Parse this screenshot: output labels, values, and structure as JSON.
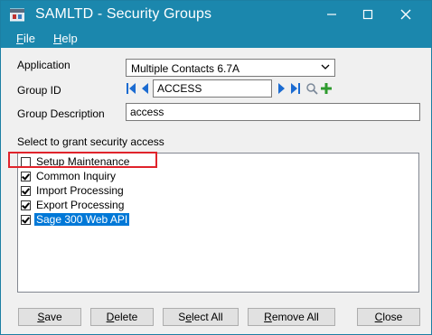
{
  "window": {
    "title": "SAMLTD - Security Groups",
    "minimize_glyph": "—",
    "maximize_glyph": "☐",
    "close_glyph": "✕"
  },
  "menu": {
    "file_hotkey": "F",
    "file_rest": "ile",
    "help_hotkey": "H",
    "help_rest": "elp"
  },
  "form": {
    "application_label": "Application",
    "application_value": "Multiple Contacts 6.7A",
    "group_id_label": "Group ID",
    "group_id_value": "ACCESS",
    "group_description_label": "Group Description",
    "group_description_value": "access",
    "grant_label": "Select to grant security access"
  },
  "permissions": [
    {
      "label": "Setup Maintenance",
      "checked": false,
      "selected": false
    },
    {
      "label": "Common Inquiry",
      "checked": true,
      "selected": false
    },
    {
      "label": "Import Processing",
      "checked": true,
      "selected": false
    },
    {
      "label": "Export Processing",
      "checked": true,
      "selected": false
    },
    {
      "label": "Sage 300 Web API",
      "checked": true,
      "selected": true
    }
  ],
  "buttons": {
    "save_hotkey": "S",
    "save_rest": "ave",
    "delete_hotkey": "D",
    "delete_rest": "elete",
    "select_all_pre": "S",
    "select_all_hotkey": "e",
    "select_all_rest": "lect All",
    "remove_all_hotkey": "R",
    "remove_all_rest": "emove All",
    "close_hotkey": "C",
    "close_rest": "lose"
  },
  "colors": {
    "titlebar": "#1b87ad",
    "highlight": "#e0232b",
    "selection": "#0078d7"
  },
  "icons": [
    "app-icon",
    "first-record-icon",
    "previous-record-icon",
    "next-record-icon",
    "last-record-icon",
    "search-icon",
    "add-icon",
    "dropdown-arrow-icon"
  ]
}
